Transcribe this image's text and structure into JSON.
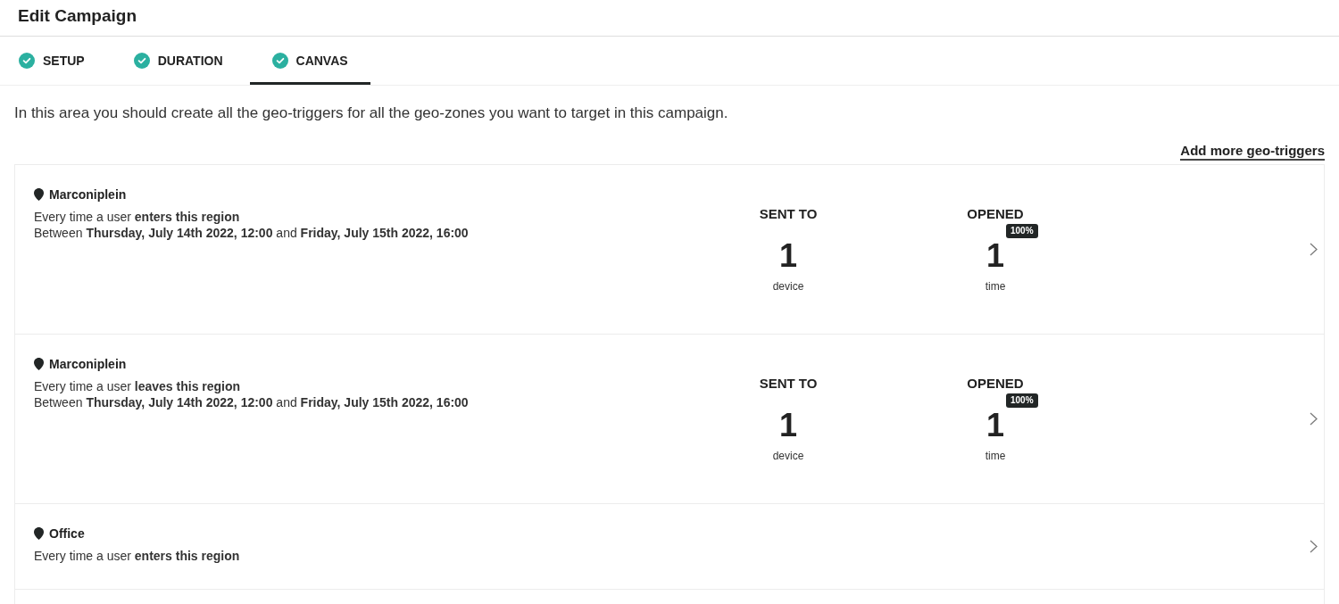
{
  "header": {
    "title": "Edit Campaign"
  },
  "tabs": [
    {
      "label": "SETUP",
      "completed": true,
      "selected": false
    },
    {
      "label": "DURATION",
      "completed": true,
      "selected": false
    },
    {
      "label": "CANVAS",
      "completed": true,
      "selected": true
    }
  ],
  "intro": "In this area you should create all the geo-triggers for all the geo-zones you want to target in this campaign.",
  "add_link": "Add more geo-triggers",
  "geo_triggers": [
    {
      "name": "Marconiplein",
      "trigger": "Every time a user **enters this region**",
      "schedule": "Between **Thursday, July 14th 2022, 12:00** and **Friday, July 15th 2022, 16:00**",
      "stats": [
        {
          "label": "SENT TO",
          "value": "1",
          "unit": "device"
        },
        {
          "label": "OPENED",
          "value": "1",
          "unit": "time",
          "badge": "100%"
        }
      ]
    },
    {
      "name": "Marconiplein",
      "trigger": "Every time a user **leaves this region**",
      "schedule": "Between **Thursday, July 14th 2022, 12:00** and **Friday, July 15th 2022, 16:00**",
      "stats": [
        {
          "label": "SENT TO",
          "value": "1",
          "unit": "device"
        },
        {
          "label": "OPENED",
          "value": "1",
          "unit": "time",
          "badge": "100%"
        }
      ]
    },
    {
      "name": "Office",
      "trigger": "Every time a user **enters this region**"
    }
  ]
}
